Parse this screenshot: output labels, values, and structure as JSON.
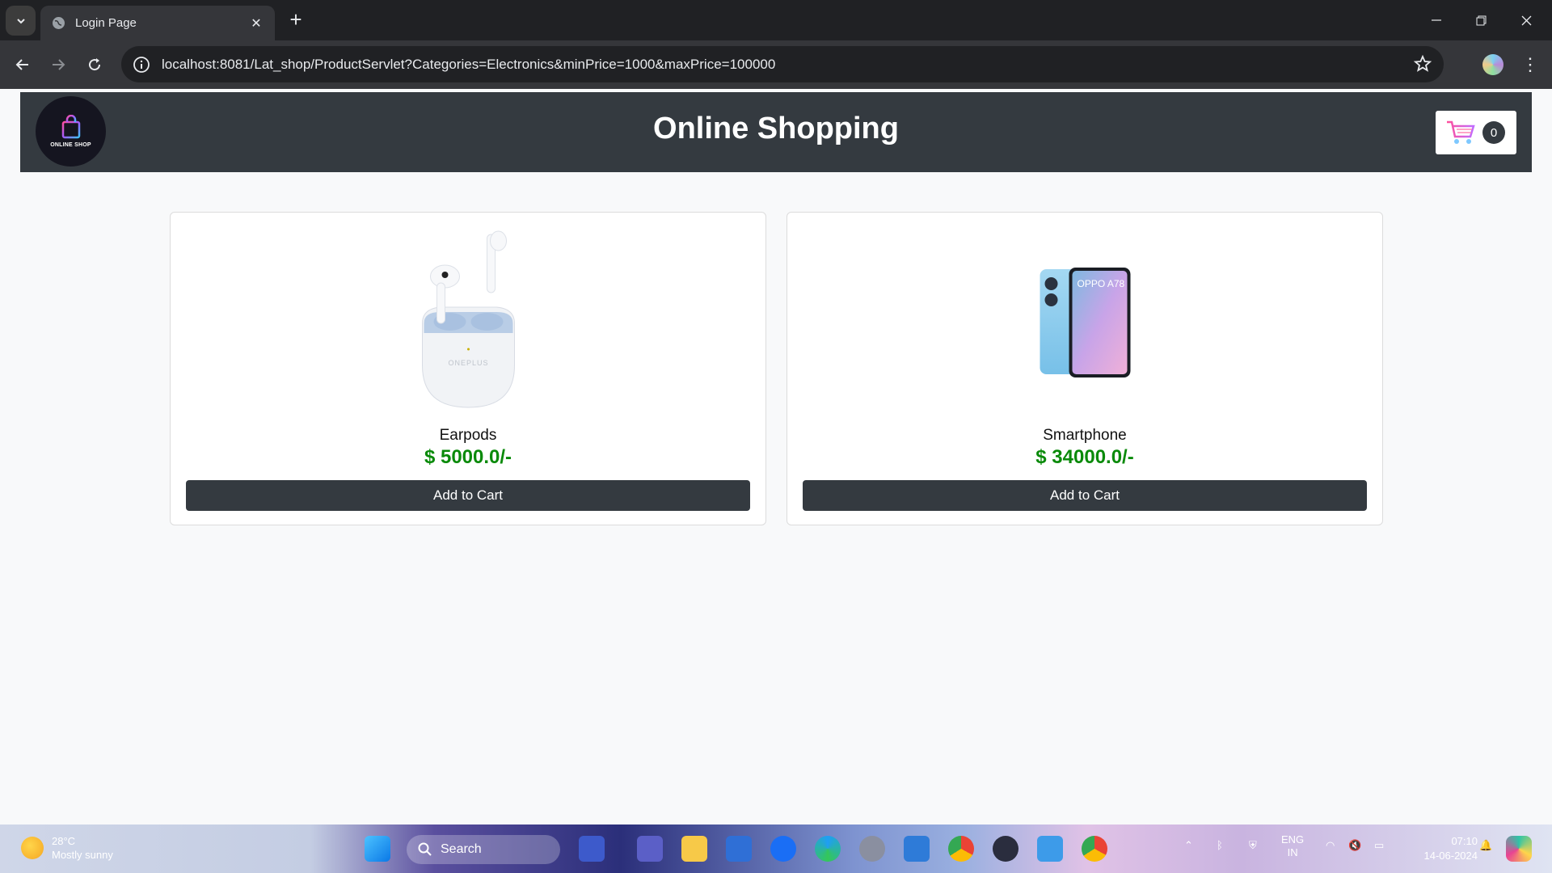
{
  "browser": {
    "tab_title": "Login Page",
    "url": "localhost:8081/Lat_shop/ProductServlet?Categories=Electronics&minPrice=1000&maxPrice=100000"
  },
  "header": {
    "logo_text": "ONLINE SHOP",
    "title": "Online Shopping",
    "cart_count": "0"
  },
  "products": [
    {
      "name": "Earpods",
      "price": "$ 5000.0/-",
      "button": "Add to Cart",
      "brand_mark": "ONEPLUS"
    },
    {
      "name": "Smartphone",
      "price": "$ 34000.0/-",
      "button": "Add to Cart",
      "brand_mark": "OPPO A78"
    }
  ],
  "taskbar": {
    "temperature": "28°C",
    "weather": "Mostly sunny",
    "search": "Search",
    "language": "ENG",
    "region": "IN",
    "time": "07:10",
    "date": "14-06-2024"
  },
  "colors": {
    "header_bg": "#343a40",
    "price": "#0a8a0a",
    "button_bg": "#343a40"
  }
}
